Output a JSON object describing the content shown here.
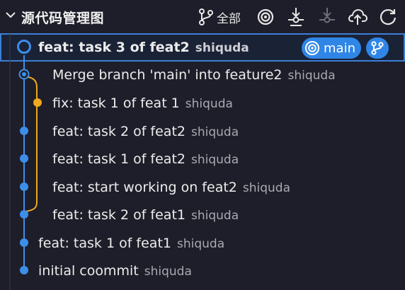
{
  "header": {
    "title": "源代码管理图",
    "all_label": "全部"
  },
  "commits": [
    {
      "message": "feat: task 3 of feat2",
      "author": "shiquda",
      "selected": true,
      "branch": "main"
    },
    {
      "message": "Merge branch 'main' into feature2",
      "author": "shiquda"
    },
    {
      "message": "fix: task 1 of feat 1",
      "author": "shiquda"
    },
    {
      "message": "feat: task 2 of feat2",
      "author": "shiquda"
    },
    {
      "message": "feat: task 1 of feat2",
      "author": "shiquda"
    },
    {
      "message": "feat: start working on feat2",
      "author": "shiquda"
    },
    {
      "message": "feat: task 2 of feat1",
      "author": "shiquda"
    },
    {
      "message": "feat: task 1 of feat1",
      "author": "shiquda"
    },
    {
      "message": "initial coommit",
      "author": "shiquda"
    }
  ],
  "colors": {
    "accent": "#2f86e6",
    "graph_blue": "#3d8ee8",
    "graph_orange": "#f0a81e"
  },
  "icons": [
    "chevron-down-icon",
    "branch-filter-icon",
    "target-icon",
    "fetch-icon",
    "pull-icon",
    "push-icon",
    "refresh-icon"
  ]
}
